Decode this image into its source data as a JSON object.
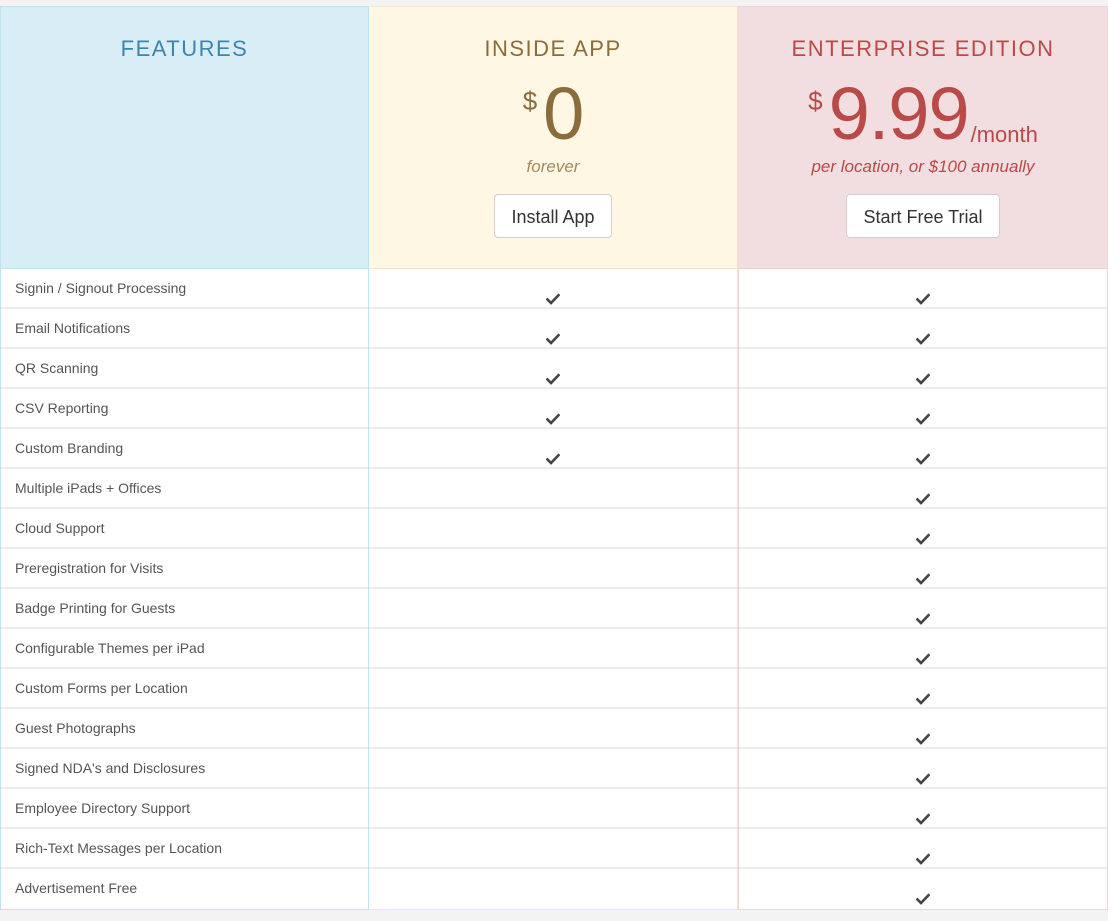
{
  "plans": {
    "features": {
      "title": "FEATURES"
    },
    "app": {
      "title": "INSIDE APP",
      "currency": "$",
      "amount": "0",
      "period": "",
      "subtitle": "forever",
      "button_label": "Install App",
      "color": "#8a6d3b",
      "bg": "#fdf7e3"
    },
    "enterprise": {
      "title": "ENTERPRISE EDITION",
      "currency": "$",
      "amount": "9.99",
      "period": "/month",
      "subtitle": "per location, or $100 annually",
      "button_label": "Start Free Trial",
      "color": "#b94a48",
      "bg": "#f2dde0"
    }
  },
  "features": [
    {
      "name": "Signin / Signout Processing",
      "app": true,
      "enterprise": true
    },
    {
      "name": "Email Notifications",
      "app": true,
      "enterprise": true
    },
    {
      "name": "QR Scanning",
      "app": true,
      "enterprise": true
    },
    {
      "name": "CSV Reporting",
      "app": true,
      "enterprise": true
    },
    {
      "name": "Custom Branding",
      "app": true,
      "enterprise": true
    },
    {
      "name": "Multiple iPads + Offices",
      "app": false,
      "enterprise": true
    },
    {
      "name": "Cloud Support",
      "app": false,
      "enterprise": true
    },
    {
      "name": "Preregistration for Visits",
      "app": false,
      "enterprise": true
    },
    {
      "name": "Badge Printing for Guests",
      "app": false,
      "enterprise": true
    },
    {
      "name": "Configurable Themes per iPad",
      "app": false,
      "enterprise": true
    },
    {
      "name": "Custom Forms per Location",
      "app": false,
      "enterprise": true
    },
    {
      "name": "Guest Photographs",
      "app": false,
      "enterprise": true
    },
    {
      "name": "Signed NDA's and Disclosures",
      "app": false,
      "enterprise": true
    },
    {
      "name": "Employee Directory Support",
      "app": false,
      "enterprise": true
    },
    {
      "name": "Rich-Text Messages per Location",
      "app": false,
      "enterprise": true
    },
    {
      "name": "Advertisement Free",
      "app": false,
      "enterprise": true
    }
  ],
  "icons": {
    "check": "check-icon"
  }
}
